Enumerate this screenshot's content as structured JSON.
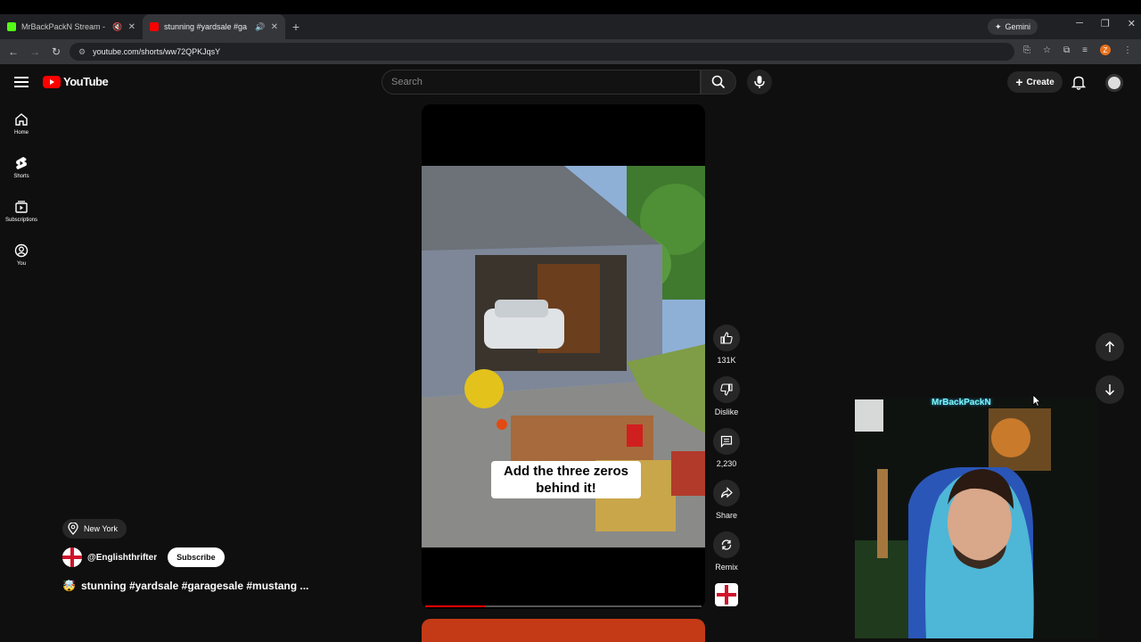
{
  "browser": {
    "tabs": [
      {
        "title": "MrBackPackN Stream - Wa",
        "active": false,
        "favicon_color": "#53fc18"
      },
      {
        "title": "stunning #yardsale #ga",
        "active": true,
        "favicon_color": "#ff0000"
      }
    ],
    "gemini_label": "Gemini",
    "url": "youtube.com/shorts/ww72QPKJqsY",
    "profile_initial": "Z"
  },
  "youtube": {
    "logo_text": "YouTube",
    "search_placeholder": "Search",
    "create_label": "Create",
    "sidebar": [
      {
        "label": "Home",
        "icon": "home-icon"
      },
      {
        "label": "Shorts",
        "icon": "shorts-icon"
      },
      {
        "label": "Subscriptions",
        "icon": "subscriptions-icon"
      },
      {
        "label": "You",
        "icon": "you-icon"
      }
    ]
  },
  "short": {
    "caption": "Add the three zeros behind it!",
    "progress_fraction": 0.22,
    "location": "New York",
    "channel": "@Englishthrifter",
    "subscribe_label": "Subscribe",
    "title": "stunning #yardsale #garagesale #mustang ...",
    "title_emoji": "🤯",
    "actions": {
      "likes": "131K",
      "dislike_label": "Dislike",
      "comments": "2,230",
      "share_label": "Share",
      "remix_label": "Remix"
    }
  },
  "overlay": {
    "streamer_label": "MrBackPackN"
  }
}
